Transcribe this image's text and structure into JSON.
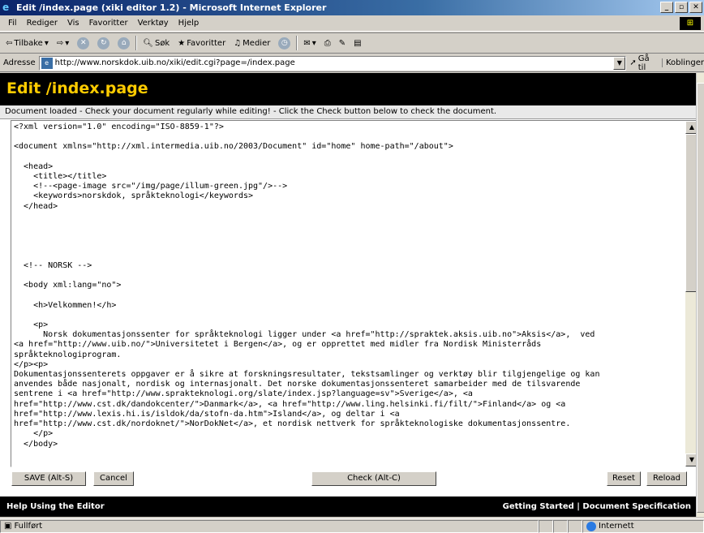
{
  "window": {
    "title": "Edit /index.page (xiki editor 1.2) - Microsoft Internet Explorer",
    "buttons": {
      "minimize": "_",
      "maximize": "▫",
      "close": "✕"
    }
  },
  "menu": [
    "Fil",
    "Rediger",
    "Vis",
    "Favoritter",
    "Verktøy",
    "Hjelp"
  ],
  "toolbar": {
    "back": "Tilbake",
    "search": "Søk",
    "favorites": "Favoritter",
    "media": "Medier"
  },
  "address": {
    "label": "Adresse",
    "url": "http://www.norskdok.uib.no/xiki/edit.cgi?page=/index.page",
    "go": "Gå til",
    "links": "Koblinger"
  },
  "editor": {
    "title": "Edit /index.page",
    "status": "Document loaded - Check your document regularly while editing! - Click the Check button below to check the document.",
    "content": "<?xml version=\"1.0\" encoding=\"ISO-8859-1\"?>\n\n<document xmlns=\"http://xml.intermedia.uib.no/2003/Document\" id=\"home\" home-path=\"/about\">\n\n  <head>\n    <title></title>\n    <!--<page-image src=\"/img/page/illum-green.jpg\"/>-->\n    <keywords>norskdok, språkteknologi</keywords>\n  </head>\n\n\n\n\n\n  <!-- NORSK -->\n\n  <body xml:lang=\"no\">\n\n    <h>Velkommen!</h>\n\n    <p>\n      Norsk dokumentasjonssenter for språkteknologi ligger under <a href=\"http://spraktek.aksis.uib.no\">Aksis</a>,  ved\n<a href=\"http://www.uib.no/\">Universitetet i Bergen</a>, og er opprettet med midler fra Nordisk Ministerråds\nspråkteknologiprogram.\n</p><p>\nDokumentasjonssenterets oppgaver er å sikre at forskningsresultater, tekstsamlinger og verktøy blir tilgjengelige og kan\nanvendes både nasjonalt, nordisk og internasjonalt. Det norske dokumentasjonssenteret samarbeider med de tilsvarende\nsentrene i <a href=\"http://www.sprakteknologi.org/slate/index.jsp?language=sv\">Sverige</a>, <a\nhref=\"http://www.cst.dk/dandokcenter/\">Danmark</a>, <a href=\"http://www.ling.helsinki.fi/filt/\">Finland</a> og <a\nhref=\"http://www.lexis.hi.is/isldok/da/stofn-da.htm\">Island</a>, og deltar i <a\nhref=\"http://www.cst.dk/nordoknet/\">NorDokNet</a>, et nordisk nettverk for språkteknologiske dokumentasjonssentre.\n    </p>\n  </body>",
    "buttons": {
      "save": "SAVE (Alt-S)",
      "cancel": "Cancel",
      "check": "Check (Alt-C)",
      "reset": "Reset",
      "reload": "Reload"
    },
    "footer": {
      "help": "Help Using the Editor",
      "getting_started": "Getting Started",
      "separator": "|",
      "doc_spec": "Document Specification"
    }
  },
  "statusbar": {
    "text": "Fullført",
    "zone": "Internett"
  }
}
